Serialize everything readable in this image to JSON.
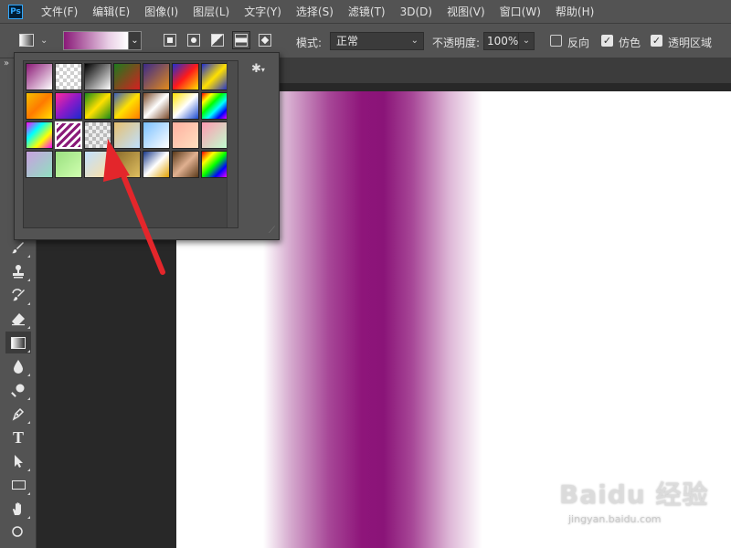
{
  "menubar": {
    "logo": "Ps",
    "items": [
      "文件(F)",
      "编辑(E)",
      "图像(I)",
      "图层(L)",
      "文字(Y)",
      "选择(S)",
      "滤镜(T)",
      "3D(D)",
      "视图(V)",
      "窗口(W)",
      "帮助(H)"
    ]
  },
  "options": {
    "mode_label": "模式:",
    "mode_value": "正常",
    "opacity_label": "不透明度:",
    "opacity_value": "100%",
    "reverse_label": "反向",
    "reverse_checked": false,
    "dither_label": "仿色",
    "dither_checked": true,
    "transparency_label": "透明区域",
    "transparency_checked": true,
    "gradient_styles": [
      "linear",
      "radial",
      "angle",
      "reflected",
      "diamond"
    ],
    "active_style": "reflected",
    "current_gradient": [
      "#8a1a78",
      "#ffffff"
    ]
  },
  "toolbar": {
    "expand_icon": "»",
    "tools": [
      "brush-tool",
      "clone-stamp-tool",
      "history-brush-tool",
      "eraser-tool",
      "gradient-tool",
      "blur-tool",
      "dodge-tool",
      "pen-tool",
      "type-tool",
      "path-selection-tool",
      "rectangle-tool",
      "hand-tool",
      "zoom-tool"
    ],
    "active_tool": "gradient-tool",
    "type_glyph": "T"
  },
  "gradient_picker": {
    "presets": [
      "linear-gradient(135deg,#8c1a77,#ffffff)",
      "repeating-conic-gradient(#ffffff 0 25%,#cfcfcf 0 50%)",
      "linear-gradient(135deg,#000000,#ffffff)",
      "linear-gradient(135deg,#1d7a1d,#d62020)",
      "linear-gradient(135deg,#3a2a8a,#e28a1c)",
      "linear-gradient(135deg,#1f2fd0,#ff1a1a,#ffe000)",
      "linear-gradient(135deg,#1f2fd0,#ffe000,#1f2fd0)",
      "linear-gradient(135deg,#f3c000,#ff7a00,#ffe000)",
      "linear-gradient(135deg,#ff2a9c,#8a1ac8,#1a2ad0)",
      "linear-gradient(135deg,#1a8a1a,#ffe000,#1a8a1a)",
      "linear-gradient(135deg,#3a5fc0,#ffe000,#ff7a00)",
      "linear-gradient(135deg,#7a4a2a,#ffffff,#7a4a2a)",
      "linear-gradient(135deg,#ffe000,#ffffff,#1a4ad0)",
      "linear-gradient(135deg,#ff0000,#ffff00,#00ff00,#00ffff,#0000ff,#ff00ff)",
      "linear-gradient(135deg,#ff00ff,#00ffff,#ffff00,#ff00ff)",
      "repeating-linear-gradient(135deg,#8a1a78 0 3px,#ffffff 3px 6px)",
      "repeating-conic-gradient(#eeeeee 0 25%,#bbbbbb 0 50%)",
      "linear-gradient(135deg,#e6c070,#bfe0ff)",
      "linear-gradient(135deg,#7ac0ff,#ffffff)",
      "linear-gradient(135deg,#ffb0a0,#ffe0c0)",
      "linear-gradient(135deg,#ff9ab0,#c0ffd0)",
      "linear-gradient(135deg,#c9a0e0,#8fe0c0)",
      "linear-gradient(135deg,#9ae080,#d0ffb0)",
      "linear-gradient(135deg,#c0e0ff,#ffe0a0)",
      "linear-gradient(135deg,#8a6a2a,#e0c060)",
      "linear-gradient(135deg,#1a3a8a,#ffffff,#e0a000)",
      "linear-gradient(135deg,#5a3a1a,#e0b090,#5a3a1a)",
      "linear-gradient(135deg,#ff0000,#ffff00,#00ff00,#0000ff,#ff00ff)"
    ],
    "selected_index": 15,
    "gear_icon": "✱"
  },
  "watermark": {
    "main": "Baidu 经验",
    "sub": "jingyan.baidu.com"
  },
  "colors": {
    "ui_panel": "#535353",
    "ui_dark": "#282828",
    "annotation_arrow": "#e3262b",
    "canvas_band": "#8a1478"
  }
}
